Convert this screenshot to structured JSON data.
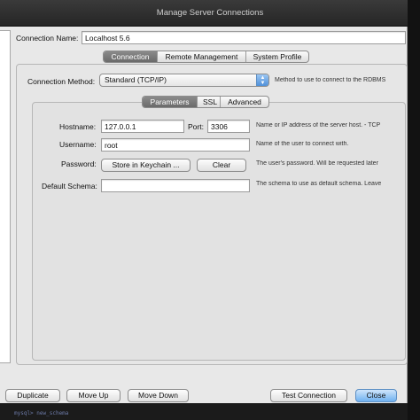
{
  "window": {
    "title": "Manage Server Connections"
  },
  "connection": {
    "name_label": "Connection Name:",
    "name_value": "Localhost 5.6"
  },
  "top_tabs": [
    {
      "label": "Connection",
      "active": true
    },
    {
      "label": "Remote Management",
      "active": false
    },
    {
      "label": "System Profile",
      "active": false
    }
  ],
  "method": {
    "label": "Connection Method:",
    "value": "Standard (TCP/IP)",
    "help": "Method to use to connect to the RDBMS"
  },
  "param_tabs": [
    {
      "label": "Parameters",
      "active": true
    },
    {
      "label": "SSL",
      "active": false
    },
    {
      "label": "Advanced",
      "active": false
    }
  ],
  "params": {
    "hostname_label": "Hostname:",
    "hostname_value": "127.0.0.1",
    "port_label": "Port:",
    "port_value": "3306",
    "hostname_help": "Name or IP address of the server host. - TCP",
    "username_label": "Username:",
    "username_value": "root",
    "username_help": "Name of the user to connect with.",
    "password_label": "Password:",
    "store_keychain": "Store in Keychain ...",
    "clear": "Clear",
    "password_help": "The user's password. Will be requested later",
    "schema_label": "Default Schema:",
    "schema_value": "",
    "schema_help": "The schema to use as default schema. Leave"
  },
  "buttons": {
    "duplicate": "Duplicate",
    "move_up": "Move Up",
    "move_down": "Move Down",
    "test_connection": "Test Connection",
    "close": "Close"
  },
  "behind_text": "mysql> new_schema"
}
